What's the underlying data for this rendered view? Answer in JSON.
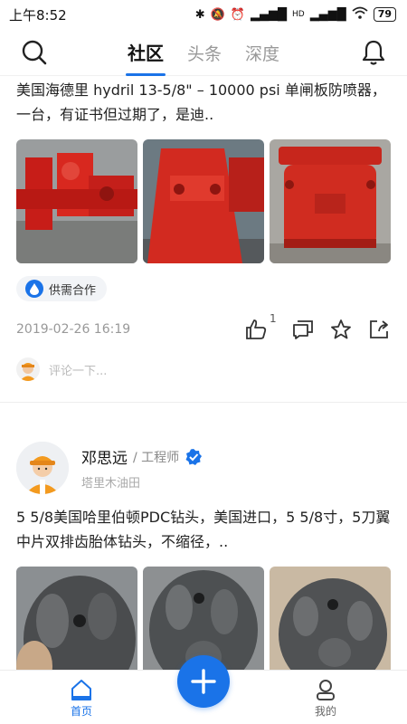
{
  "status_bar": {
    "time": "上午8:52",
    "signal_label": "HD",
    "battery": "79"
  },
  "nav": {
    "tabs": [
      {
        "label": "社区",
        "active": true
      },
      {
        "label": "头条",
        "active": false
      },
      {
        "label": "深度",
        "active": false
      }
    ]
  },
  "post1": {
    "text": "美国海德里 hydril 13-5/8\" – 10000 psi 单闸板防喷器，一台，有证书但过期了，是迪..",
    "images": [
      "red-bop-image-1",
      "red-bop-image-2",
      "red-bop-image-3"
    ],
    "tag": "供需合作",
    "date": "2019-02-26 16:19",
    "likes": "1",
    "comment_placeholder": "评论一下..."
  },
  "post2": {
    "author_name": "邓思远",
    "author_title": "/ 工程师",
    "author_org": "塔里木油田",
    "text": "5 5/8美国哈里伯顿PDC钻头，美国进口，5 5/8寸，5刀翼中片双排齿胎体钻头，不缩径，..",
    "images": [
      "drill-bit-image-1",
      "drill-bit-image-2",
      "drill-bit-image-3"
    ]
  },
  "bottom_nav": {
    "home_label": "首页",
    "mine_label": "我的"
  },
  "colors": {
    "accent": "#1a73e8",
    "bop_red": "#d8281f"
  }
}
